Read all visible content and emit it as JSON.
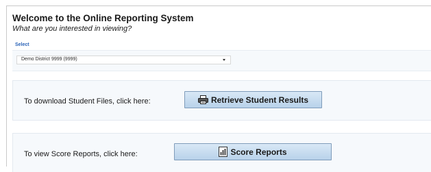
{
  "header": {
    "title": "Welcome to the Online Reporting System",
    "subtitle": "What are you interested in viewing?"
  },
  "selector": {
    "label": "Select",
    "selected_value": "Demo District 9999 (9999)"
  },
  "download_section": {
    "text": "To download Student Files, click here:",
    "button_label": "Retrieve Student Results",
    "button_icon": "printer-icon"
  },
  "reports_section": {
    "text": "To view Score Reports, click here:",
    "button_label": "Score Reports",
    "button_icon": "report-chart-icon"
  },
  "colors": {
    "select_label": "#2b64b8",
    "button_top": "#d9e8f6",
    "button_bottom": "#b8d2ea",
    "button_border": "#7f9cba",
    "panel_bg": "#f6f9fc"
  }
}
